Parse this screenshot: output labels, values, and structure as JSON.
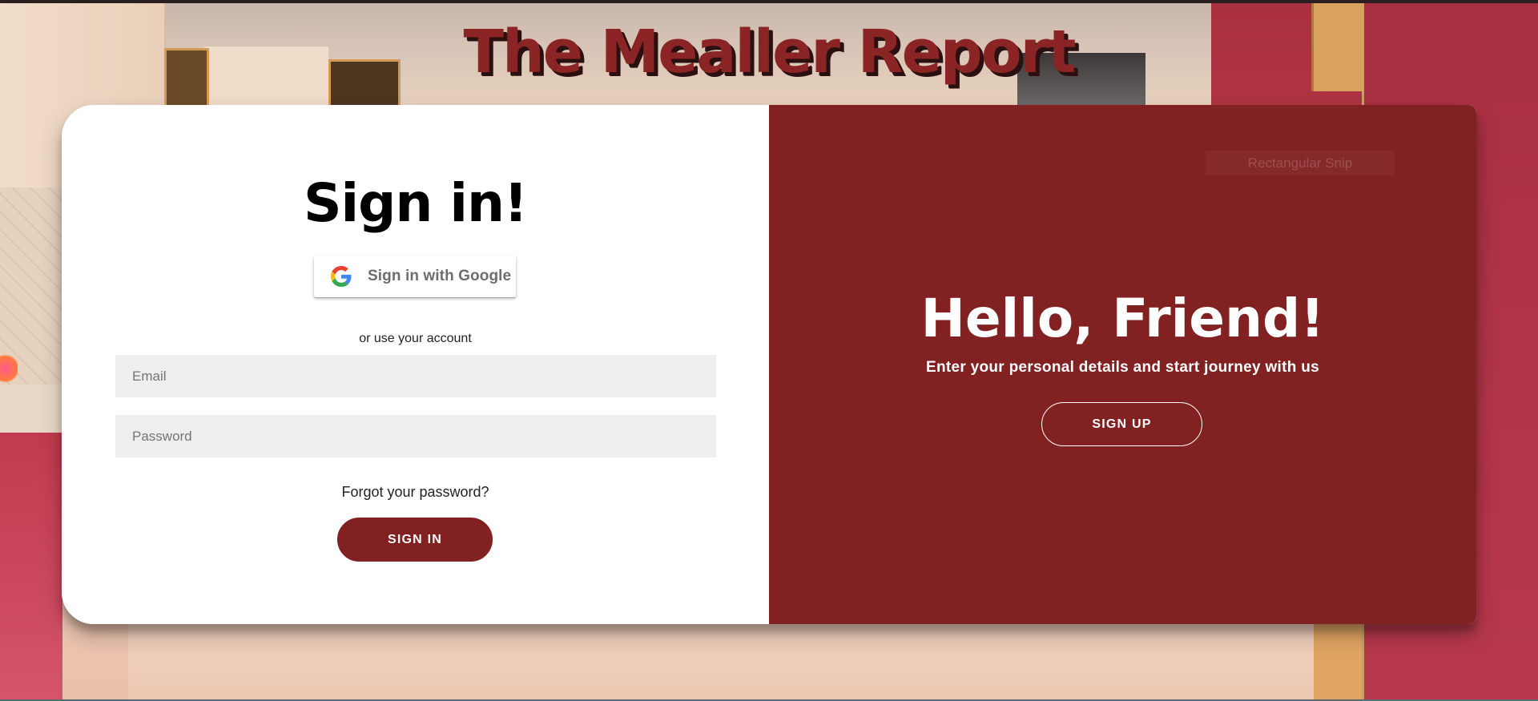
{
  "site": {
    "title": "The Mealler Report"
  },
  "sign_in": {
    "heading": "Sign in!",
    "google_button_label": "Sign in with Google",
    "divider_text": "or use your account",
    "email_placeholder": "Email",
    "password_placeholder": "Password",
    "forgot_password_label": "Forgot your password?",
    "submit_label": "SIGN IN"
  },
  "sign_up_panel": {
    "heading": "Hello, Friend!",
    "subtext": "Enter your personal details and start journey with us",
    "button_label": "SIGN UP"
  },
  "overlay": {
    "snip_label": "Rectangular Snip"
  },
  "icons": {
    "google": "google-icon"
  },
  "colors": {
    "accent": "#822121",
    "title": "#8b2525",
    "input_bg": "#eeeeee"
  }
}
